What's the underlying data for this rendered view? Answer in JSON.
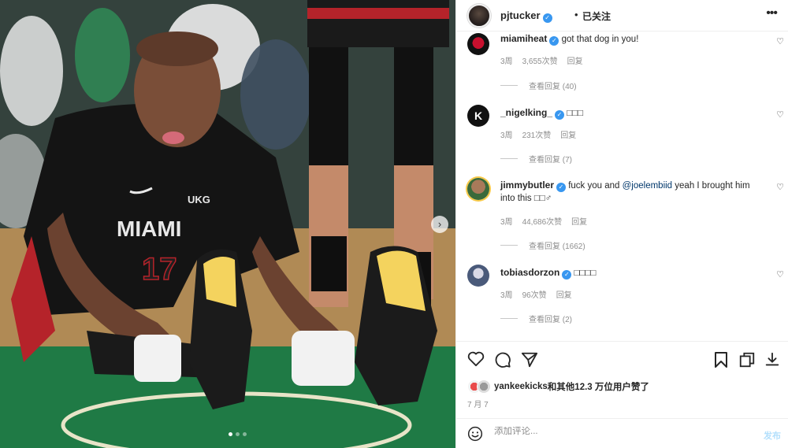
{
  "post_author": {
    "username": "pjtucker",
    "separator": "•",
    "follow_label": "已关注",
    "more_icon": "more-dots-icon"
  },
  "photo": {
    "jersey_team": "MIAMI",
    "jersey_number": "17",
    "jersey_sponsor": "UKG",
    "next_icon": "chevron-right-icon"
  },
  "comments": [
    {
      "username": "miamiheat",
      "text": "got that dog in you!",
      "time": "3周",
      "likes": "3,655次赞",
      "reply": "回复",
      "view_replies": "查看回复 (40)"
    },
    {
      "username": "_nigelking_",
      "text": "□□□",
      "time": "3周",
      "likes": "231次赞",
      "reply": "回复",
      "view_replies": "查看回复 (7)"
    },
    {
      "username": "jimmybutler",
      "text_before": "fuck you and ",
      "mention": "@joelembiid",
      "text_after": " yeah I brought him into this □□♂",
      "time": "3周",
      "likes": "44,686次赞",
      "reply": "回复",
      "view_replies": "查看回复 (1662)"
    },
    {
      "username": "tobiasdorzon",
      "text": "□□□□",
      "time": "3周",
      "likes": "96次赞",
      "reply": "回复",
      "view_replies": "查看回复 (2)"
    }
  ],
  "likes_summary": {
    "liked_by": "yankeekicks",
    "rest": "和其他12.3 万位用户赞了"
  },
  "date": "7 月 7",
  "add_comment": {
    "placeholder": "添加评论...",
    "post_label": "发布"
  },
  "colors": {
    "verified": "#3897f0",
    "link": "#00376b",
    "muted": "#8e8e8e",
    "post_disabled": "#b2dffc"
  }
}
